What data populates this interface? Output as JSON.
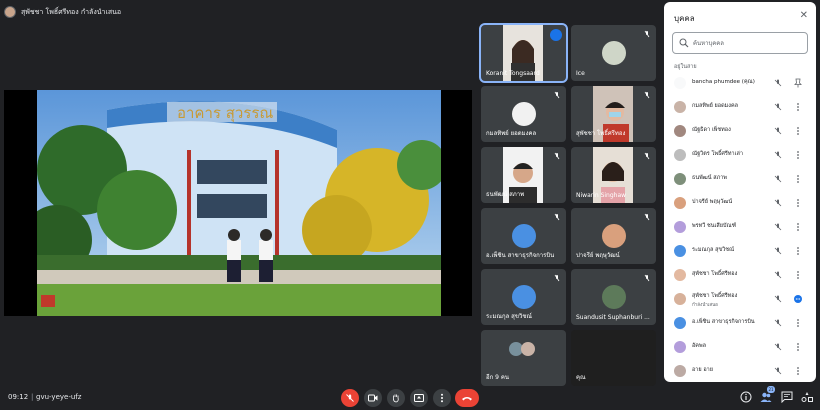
{
  "presenter": {
    "label": "สุพัชชา โพธิ์ศรีทอง กำลังนำเสนอ"
  },
  "tiles": [
    {
      "name": "Koranit Tongsaard"
    },
    {
      "name": "Ice"
    },
    {
      "name": "กมลทิพย์ ยอดมงคล"
    },
    {
      "name": "สุพัชชา โพธิ์ศรีทอง"
    },
    {
      "name": "ธนพัฒน์ สภาพ"
    },
    {
      "name": "Niwarin Singhaw"
    },
    {
      "name": "อ.เพ็ชิน สาขาธุรกิจการบิน"
    },
    {
      "name": "ปาจรีย์ พฤษุวัฒน์"
    },
    {
      "name": "ระมณกุล สุขวิชณ์"
    },
    {
      "name": "Suandusit Suphanburi ..."
    },
    {
      "name": "อีก 9 คน"
    },
    {
      "name": "คุณ"
    }
  ],
  "panel": {
    "title": "บุคคล",
    "close": "✕",
    "search_placeholder": "ค้นหาบุคคล",
    "section": "อยู่ในสาย",
    "people": [
      {
        "name": "bancha phumdee (คุณ)",
        "sub": ""
      },
      {
        "name": "กมลทิพย์ ยอดมงคล",
        "sub": ""
      },
      {
        "name": "ณัฐธิดา เพ็ชทอง",
        "sub": ""
      },
      {
        "name": "ณัฐวิตร โพธิ์ศรีทาเล่า",
        "sub": ""
      },
      {
        "name": "ธนพัฒน์ สภาพ",
        "sub": ""
      },
      {
        "name": "ปาจรีย์ พฤษุวัฒน์",
        "sub": ""
      },
      {
        "name": "พรทวี ชนเสียบัณฑ์",
        "sub": ""
      },
      {
        "name": "ระมณกุล สุขวิชณ์",
        "sub": ""
      },
      {
        "name": "สุพัชชา โพธิ์ศรีทอง",
        "sub": ""
      },
      {
        "name": "สุพัชชา โพธิ์ศรีทอง",
        "sub": "กำลังนำเสนอ"
      },
      {
        "name": "อ.เพ็ชิน สาขาธุรกิจการบิน",
        "sub": ""
      },
      {
        "name": "อัคพล",
        "sub": ""
      },
      {
        "name": "อาย อาย",
        "sub": ""
      }
    ]
  },
  "bottom": {
    "time": "09:12",
    "separator": "|",
    "meeting_code": "gvu-yeye-ufz",
    "people_count": "21"
  },
  "colors": {
    "accent": "#8ab4f8",
    "end_call": "#ea4335",
    "background": "#202124"
  },
  "icons": [
    "mic-off-icon",
    "camera-icon",
    "hand-icon",
    "present-icon",
    "more-icon",
    "end-call-icon",
    "info-icon",
    "people-icon",
    "chat-icon",
    "activities-icon"
  ]
}
